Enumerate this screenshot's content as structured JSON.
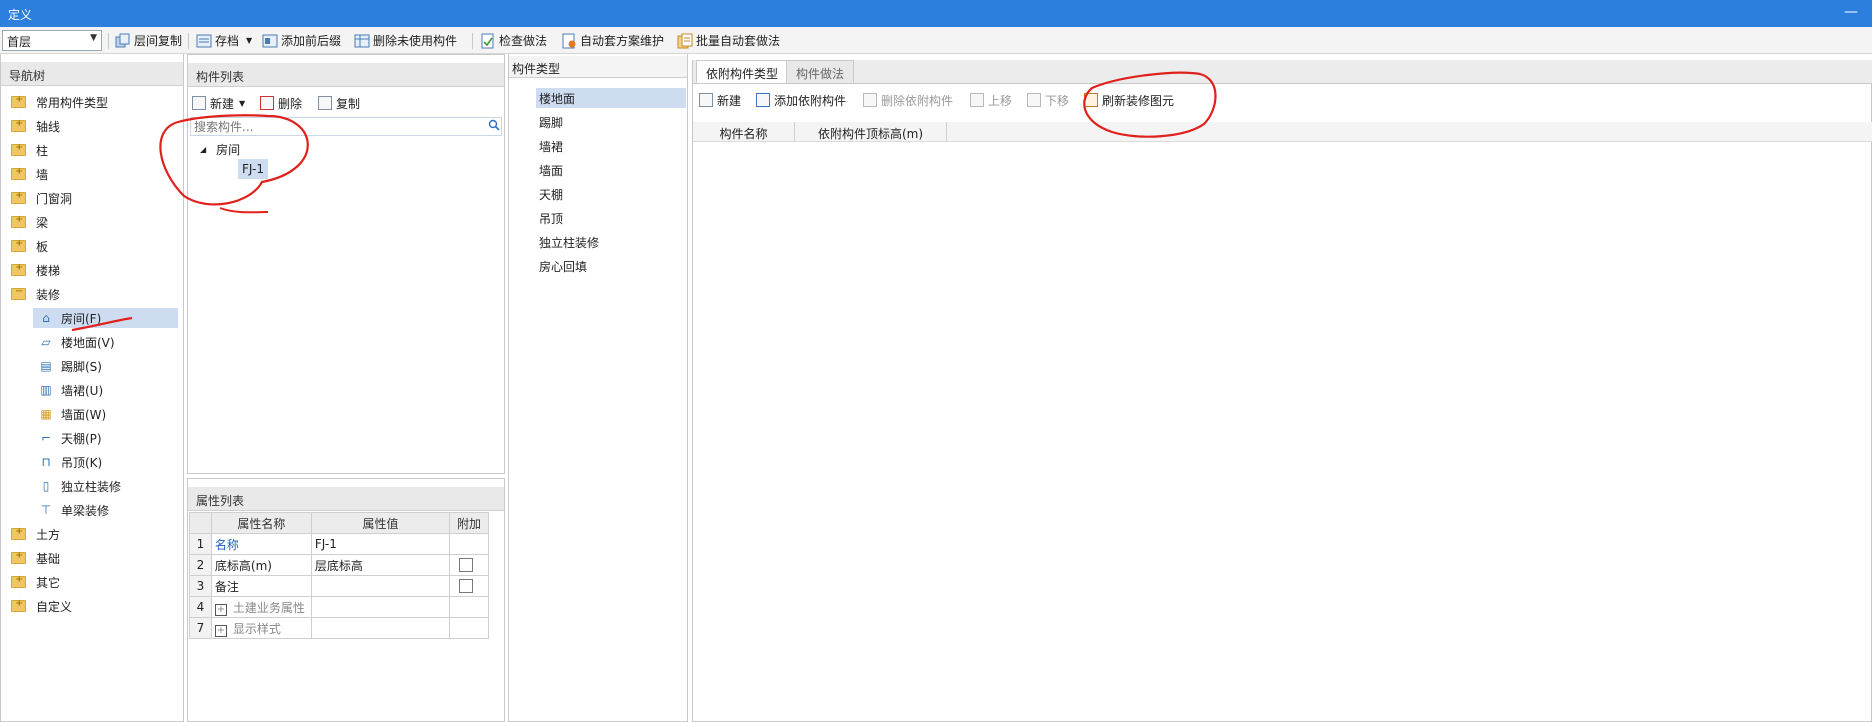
{
  "window": {
    "title": "定义",
    "minimize_glyph": "—"
  },
  "toolbar": {
    "floor_value": "首层",
    "buttons": [
      "层间复制",
      "存档",
      "添加前后缀",
      "删除未使用构件",
      "检查做法",
      "自动套方案维护",
      "批量自动套做法"
    ]
  },
  "nav": {
    "header": "导航树",
    "groups": [
      "常用构件类型",
      "轴线",
      "柱",
      "墙",
      "门窗洞",
      "梁",
      "板",
      "楼梯",
      "装修"
    ],
    "sub_items": [
      "房间(F)",
      "楼地面(V)",
      "踢脚(S)",
      "墙裙(U)",
      "墙面(W)",
      "天棚(P)",
      "吊顶(K)",
      "独立柱装修",
      "单梁装修"
    ],
    "groups_after": [
      "土方",
      "基础",
      "其它",
      "自定义"
    ]
  },
  "component_list": {
    "header": "构件列表",
    "buttons": [
      "新建",
      "删除",
      "复制"
    ],
    "search_placeholder": "搜索构件...",
    "tree_root": "房间",
    "tree_child": "FJ-1"
  },
  "property_list": {
    "header": "属性列表",
    "columns": [
      "属性名称",
      "属性值",
      "附加"
    ],
    "rows": [
      {
        "num": "1",
        "name": "名称",
        "value": "FJ-1"
      },
      {
        "num": "2",
        "name": "底标高(m)",
        "value": "层底标高"
      },
      {
        "num": "3",
        "name": "备注",
        "value": ""
      },
      {
        "num": "4",
        "name": "土建业务属性",
        "value": ""
      },
      {
        "num": "7",
        "name": "显示样式",
        "value": ""
      }
    ]
  },
  "component_types": {
    "header": "构件类型",
    "items": [
      "楼地面",
      "踢脚",
      "墙裙",
      "墙面",
      "天棚",
      "吊顶",
      "独立柱装修",
      "房心回填"
    ]
  },
  "attached": {
    "tabs": [
      "依附构件类型",
      "构件做法"
    ],
    "buttons": [
      "新建",
      "添加依附构件",
      "删除依附构件",
      "上移",
      "下移",
      "刷新装修图元"
    ],
    "columns": [
      "构件名称",
      "依附构件顶标高(m)"
    ]
  },
  "colors": {
    "titlebar": "#2d7fde",
    "selection": "#cddcf0",
    "annotation": "#e0201b"
  }
}
